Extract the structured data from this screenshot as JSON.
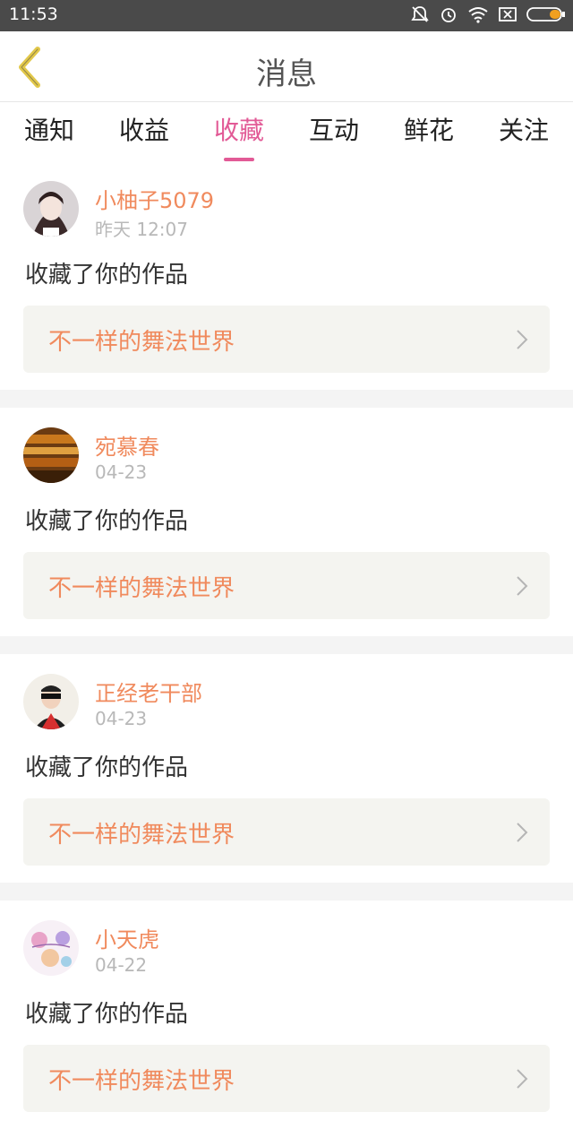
{
  "status_bar": {
    "time": "11:53",
    "icons": [
      "bell-off-icon",
      "alarm-icon",
      "wifi-icon",
      "sim-icon",
      "battery-icon"
    ],
    "battery_color": "#f0a020"
  },
  "header": {
    "title": "消息",
    "back_icon": "chevron-left-icon",
    "back_color": "#e2c84a"
  },
  "tabs": [
    {
      "label": "通知",
      "active": false
    },
    {
      "label": "收益",
      "active": false
    },
    {
      "label": "收藏",
      "active": true
    },
    {
      "label": "互动",
      "active": false
    },
    {
      "label": "鲜花",
      "active": false
    },
    {
      "label": "关注",
      "active": false
    }
  ],
  "accent_color": "#e25a96",
  "username_color": "#f08a5d",
  "items": [
    {
      "username": "小柚子5079",
      "time": "昨天 12:07",
      "action": "收藏了你的作品",
      "work_title": "不一样的舞法世界"
    },
    {
      "username": "宛慕春",
      "time": "04-23",
      "action": "收藏了你的作品",
      "work_title": "不一样的舞法世界"
    },
    {
      "username": "正经老干部",
      "time": "04-23",
      "action": "收藏了你的作品",
      "work_title": "不一样的舞法世界"
    },
    {
      "username": "小天虎",
      "time": "04-22",
      "action": "收藏了你的作品",
      "work_title": "不一样的舞法世界"
    }
  ]
}
